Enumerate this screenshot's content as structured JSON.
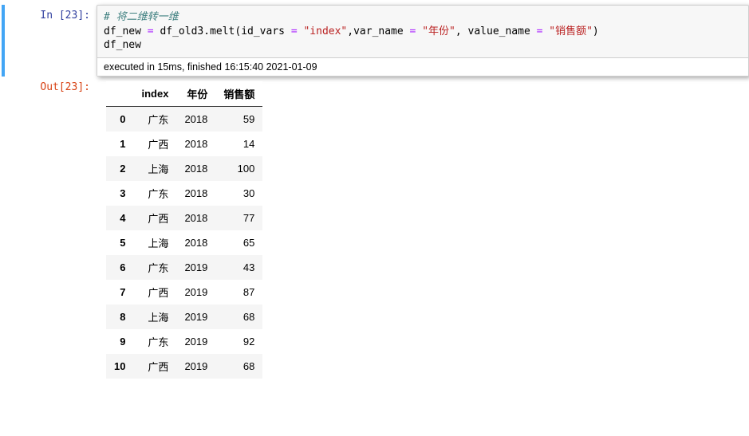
{
  "in_prompt": "In [23]:",
  "out_prompt": "Out[23]:",
  "code": {
    "comment": "# 将二维转一维",
    "line2_pre": "df_new ",
    "line2_eq": "=",
    "line2_mid": " df_old3.melt(id_vars ",
    "line2_eq2": "=",
    "line2_sp": " ",
    "line2_str1": "\"index\"",
    "line2_c1": ",var_name ",
    "line2_eq3": "=",
    "line2_sp2": " ",
    "line2_str2": "\"年份\"",
    "line2_c2": ", value_name ",
    "line2_eq4": "=",
    "line2_sp3": " ",
    "line2_str3": "\"销售额\"",
    "line2_close": ")",
    "line3": "df_new"
  },
  "exec_info": "executed in 15ms, finished 16:15:40 2021-01-09",
  "table": {
    "headers": [
      "",
      "index",
      "年份",
      "销售额"
    ],
    "rows": [
      {
        "i": "0",
        "c0": "广东",
        "c1": "2018",
        "c2": "59"
      },
      {
        "i": "1",
        "c0": "广西",
        "c1": "2018",
        "c2": "14"
      },
      {
        "i": "2",
        "c0": "上海",
        "c1": "2018",
        "c2": "100"
      },
      {
        "i": "3",
        "c0": "广东",
        "c1": "2018",
        "c2": "30"
      },
      {
        "i": "4",
        "c0": "广西",
        "c1": "2018",
        "c2": "77"
      },
      {
        "i": "5",
        "c0": "上海",
        "c1": "2018",
        "c2": "65"
      },
      {
        "i": "6",
        "c0": "广东",
        "c1": "2019",
        "c2": "43"
      },
      {
        "i": "7",
        "c0": "广西",
        "c1": "2019",
        "c2": "87"
      },
      {
        "i": "8",
        "c0": "上海",
        "c1": "2019",
        "c2": "68"
      },
      {
        "i": "9",
        "c0": "广东",
        "c1": "2019",
        "c2": "92"
      },
      {
        "i": "10",
        "c0": "广西",
        "c1": "2019",
        "c2": "68"
      }
    ]
  }
}
